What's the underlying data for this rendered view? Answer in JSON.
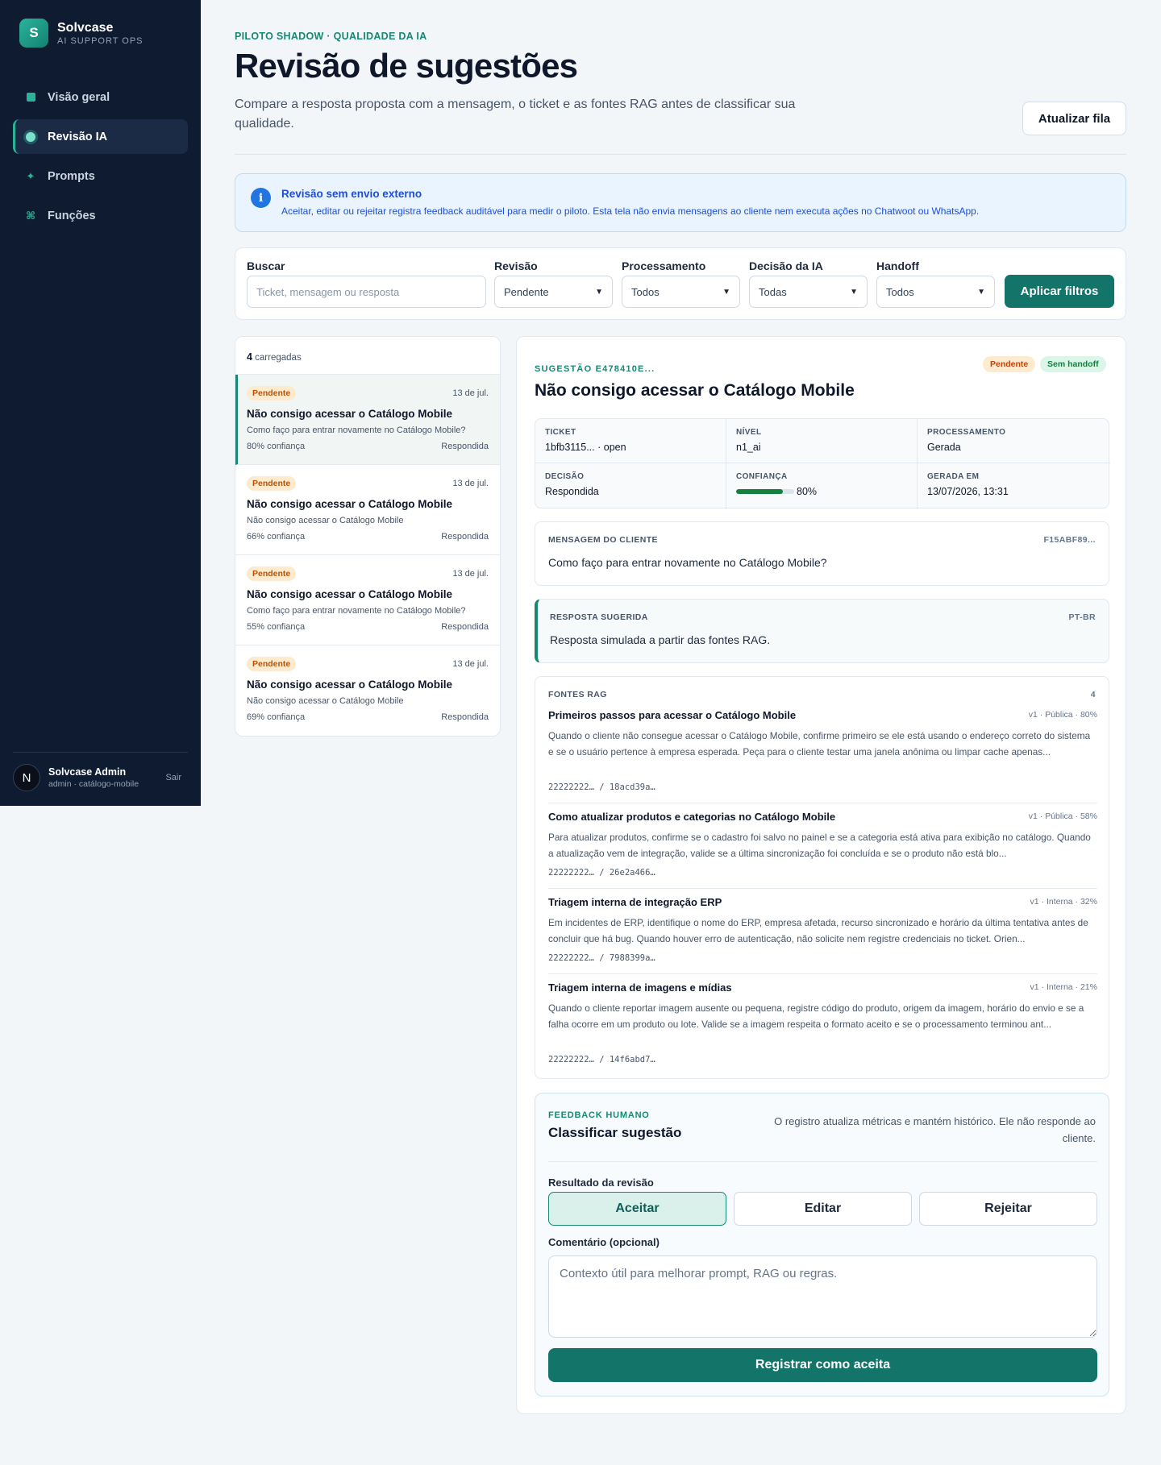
{
  "sidebar": {
    "brand": {
      "logo_letter": "S",
      "name": "Solvcase",
      "sub": "AI SUPPORT OPS"
    },
    "items": [
      {
        "label": "Visão geral",
        "icon": "grid-square-icon"
      },
      {
        "label": "Revisão IA",
        "icon": "dot-icon",
        "active": true
      },
      {
        "label": "Prompts",
        "icon": "sparkle-icon"
      },
      {
        "label": "Funções",
        "icon": "command-icon"
      }
    ],
    "user": {
      "initial": "N",
      "name": "Solvcase Admin",
      "sub": "admin · catálogo-mobile",
      "logout": "Sair"
    }
  },
  "header": {
    "eyebrow": "PILOTO SHADOW · QUALIDADE DA IA",
    "title": "Revisão de sugestões",
    "description": "Compare a resposta proposta com a mensagem, o ticket e as fontes RAG antes de classificar sua qualidade.",
    "refresh_label": "Atualizar fila"
  },
  "notice": {
    "icon": "i",
    "title": "Revisão sem envio externo",
    "text": "Aceitar, editar ou rejeitar registra feedback auditável para medir o piloto. Esta tela não envia mensagens ao cliente nem executa ações no Chatwoot ou WhatsApp."
  },
  "filters": {
    "search": {
      "label": "Buscar",
      "placeholder": "Ticket, mensagem ou resposta"
    },
    "review": {
      "label": "Revisão",
      "value": "Pendente"
    },
    "processing": {
      "label": "Processamento",
      "value": "Todos"
    },
    "decision": {
      "label": "Decisão da IA",
      "value": "Todas"
    },
    "handoff": {
      "label": "Handoff",
      "value": "Todos"
    },
    "apply_label": "Aplicar filtros"
  },
  "list": {
    "count": "4",
    "count_label": "carregadas",
    "items": [
      {
        "badge": "Pendente",
        "date": "13 de jul.",
        "title": "Não consigo acessar o Catálogo Mobile",
        "snippet": "Como faço para entrar novamente no Catálogo Mobile?",
        "confidence": "80% confiança",
        "status": "Respondida"
      },
      {
        "badge": "Pendente",
        "date": "13 de jul.",
        "title": "Não consigo acessar o Catálogo Mobile",
        "snippet": "Não consigo acessar o Catálogo Mobile",
        "confidence": "66% confiança",
        "status": "Respondida"
      },
      {
        "badge": "Pendente",
        "date": "13 de jul.",
        "title": "Não consigo acessar o Catálogo Mobile",
        "snippet": "Como faço para entrar novamente no Catálogo Mobile?",
        "confidence": "55% confiança",
        "status": "Respondida"
      },
      {
        "badge": "Pendente",
        "date": "13 de jul.",
        "title": "Não consigo acessar o Catálogo Mobile",
        "snippet": "Não consigo acessar o Catálogo Mobile",
        "confidence": "69% confiança",
        "status": "Respondida"
      }
    ]
  },
  "detail": {
    "eyebrow": "SUGESTÃO E478410E...",
    "title": "Não consigo acessar o Catálogo Mobile",
    "badge_status": "Pendente",
    "badge_handoff": "Sem handoff",
    "meta": {
      "ticket_label": "TICKET",
      "ticket_value": "1bfb3115... · open",
      "level_label": "NÍVEL",
      "level_value": "n1_ai",
      "processing_label": "PROCESSAMENTO",
      "processing_value": "Gerada",
      "decision_label": "DECISÃO",
      "decision_value": "Respondida",
      "confidence_label": "CONFIANÇA",
      "confidence_value": "80%",
      "confidence_fraction": 0.8,
      "generated_label": "GERADA EM",
      "generated_value": "13/07/2026, 13:31"
    },
    "customer_message": {
      "label": "MENSAGEM DO CLIENTE",
      "id": "F15ABF89...",
      "text": "Como faço para entrar novamente no Catálogo Mobile?"
    },
    "suggested_reply": {
      "label": "RESPOSTA SUGERIDA",
      "lang": "PT-BR",
      "text": "Resposta simulada a partir das fontes RAG."
    },
    "rag": {
      "label": "FONTES RAG",
      "count": "4",
      "sources": [
        {
          "title": "Primeiros passos para acessar o Catálogo Mobile",
          "meta": "v1 · Pública · 80%",
          "body": "Quando o cliente não consegue acessar o Catálogo Mobile, confirme primeiro se ele está usando o endereço correto do sistema e se o usuário pertence à empresa esperada. Peça para o cliente testar uma janela anônima ou limpar cache apenas...",
          "id": "22222222… / 18acd39a…"
        },
        {
          "title": "Como atualizar produtos e categorias no Catálogo Mobile",
          "meta": "v1 · Pública · 58%",
          "body": "Para atualizar produtos, confirme se o cadastro foi salvo no painel e se a categoria está ativa para exibição no catálogo. Quando a atualização vem de integração, valide se a última sincronização foi concluída e se o produto não está blo...",
          "id": "22222222… / 26e2a466…"
        },
        {
          "title": "Triagem interna de integração ERP",
          "meta": "v1 · Interna · 32%",
          "body": "Em incidentes de ERP, identifique o nome do ERP, empresa afetada, recurso sincronizado e horário da última tentativa antes de concluir que há bug. Quando houver erro de autenticação, não solicite nem registre credenciais no ticket. Orien...",
          "id": "22222222… / 7988399a…"
        },
        {
          "title": "Triagem interna de imagens e mídias",
          "meta": "v1 · Interna · 21%",
          "body": "Quando o cliente reportar imagem ausente ou pequena, registre código do produto, origem da imagem, horário do envio e se a falha ocorre em um produto ou lote. Valide se a imagem respeita o formato aceito e se o processamento terminou ant...",
          "id": "22222222… / 14f6abd7…"
        }
      ]
    },
    "feedback": {
      "eyebrow": "FEEDBACK HUMANO",
      "title": "Classificar sugestão",
      "note": "O registro atualiza métricas e mantém histórico. Ele não responde ao cliente.",
      "result_label": "Resultado da revisão",
      "options": [
        "Aceitar",
        "Editar",
        "Rejeitar"
      ],
      "selected": "Aceitar",
      "comment_label": "Comentário (opcional)",
      "comment_placeholder": "Contexto útil para melhorar prompt, RAG ou regras.",
      "submit_label": "Registrar como aceita"
    }
  },
  "colors": {
    "sidebar_bg": "#0f1b31",
    "accent": "#168873",
    "primary_button": "#13746a",
    "pending": "#b45309",
    "info": "#1d4ed8"
  }
}
